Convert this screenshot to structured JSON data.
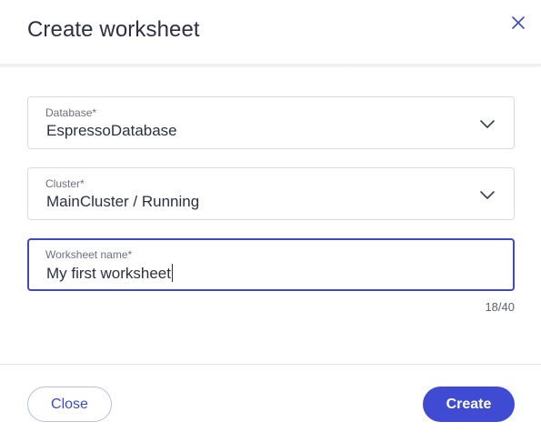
{
  "dialog": {
    "title": "Create worksheet",
    "close_icon": "close-icon"
  },
  "fields": {
    "database": {
      "label": "Database*",
      "value": "EspressoDatabase",
      "icon": "chevron-down-icon"
    },
    "cluster": {
      "label": "Cluster*",
      "value": "MainCluster / Running",
      "icon": "chevron-down-icon"
    },
    "worksheet_name": {
      "label": "Worksheet name*",
      "value": "My first worksheet",
      "counter": "18/40"
    }
  },
  "footer": {
    "close_label": "Close",
    "create_label": "Create"
  },
  "colors": {
    "accent": "#3e4bd2",
    "focus_border": "#3e4bc0",
    "field_border": "#d9dbe1"
  }
}
